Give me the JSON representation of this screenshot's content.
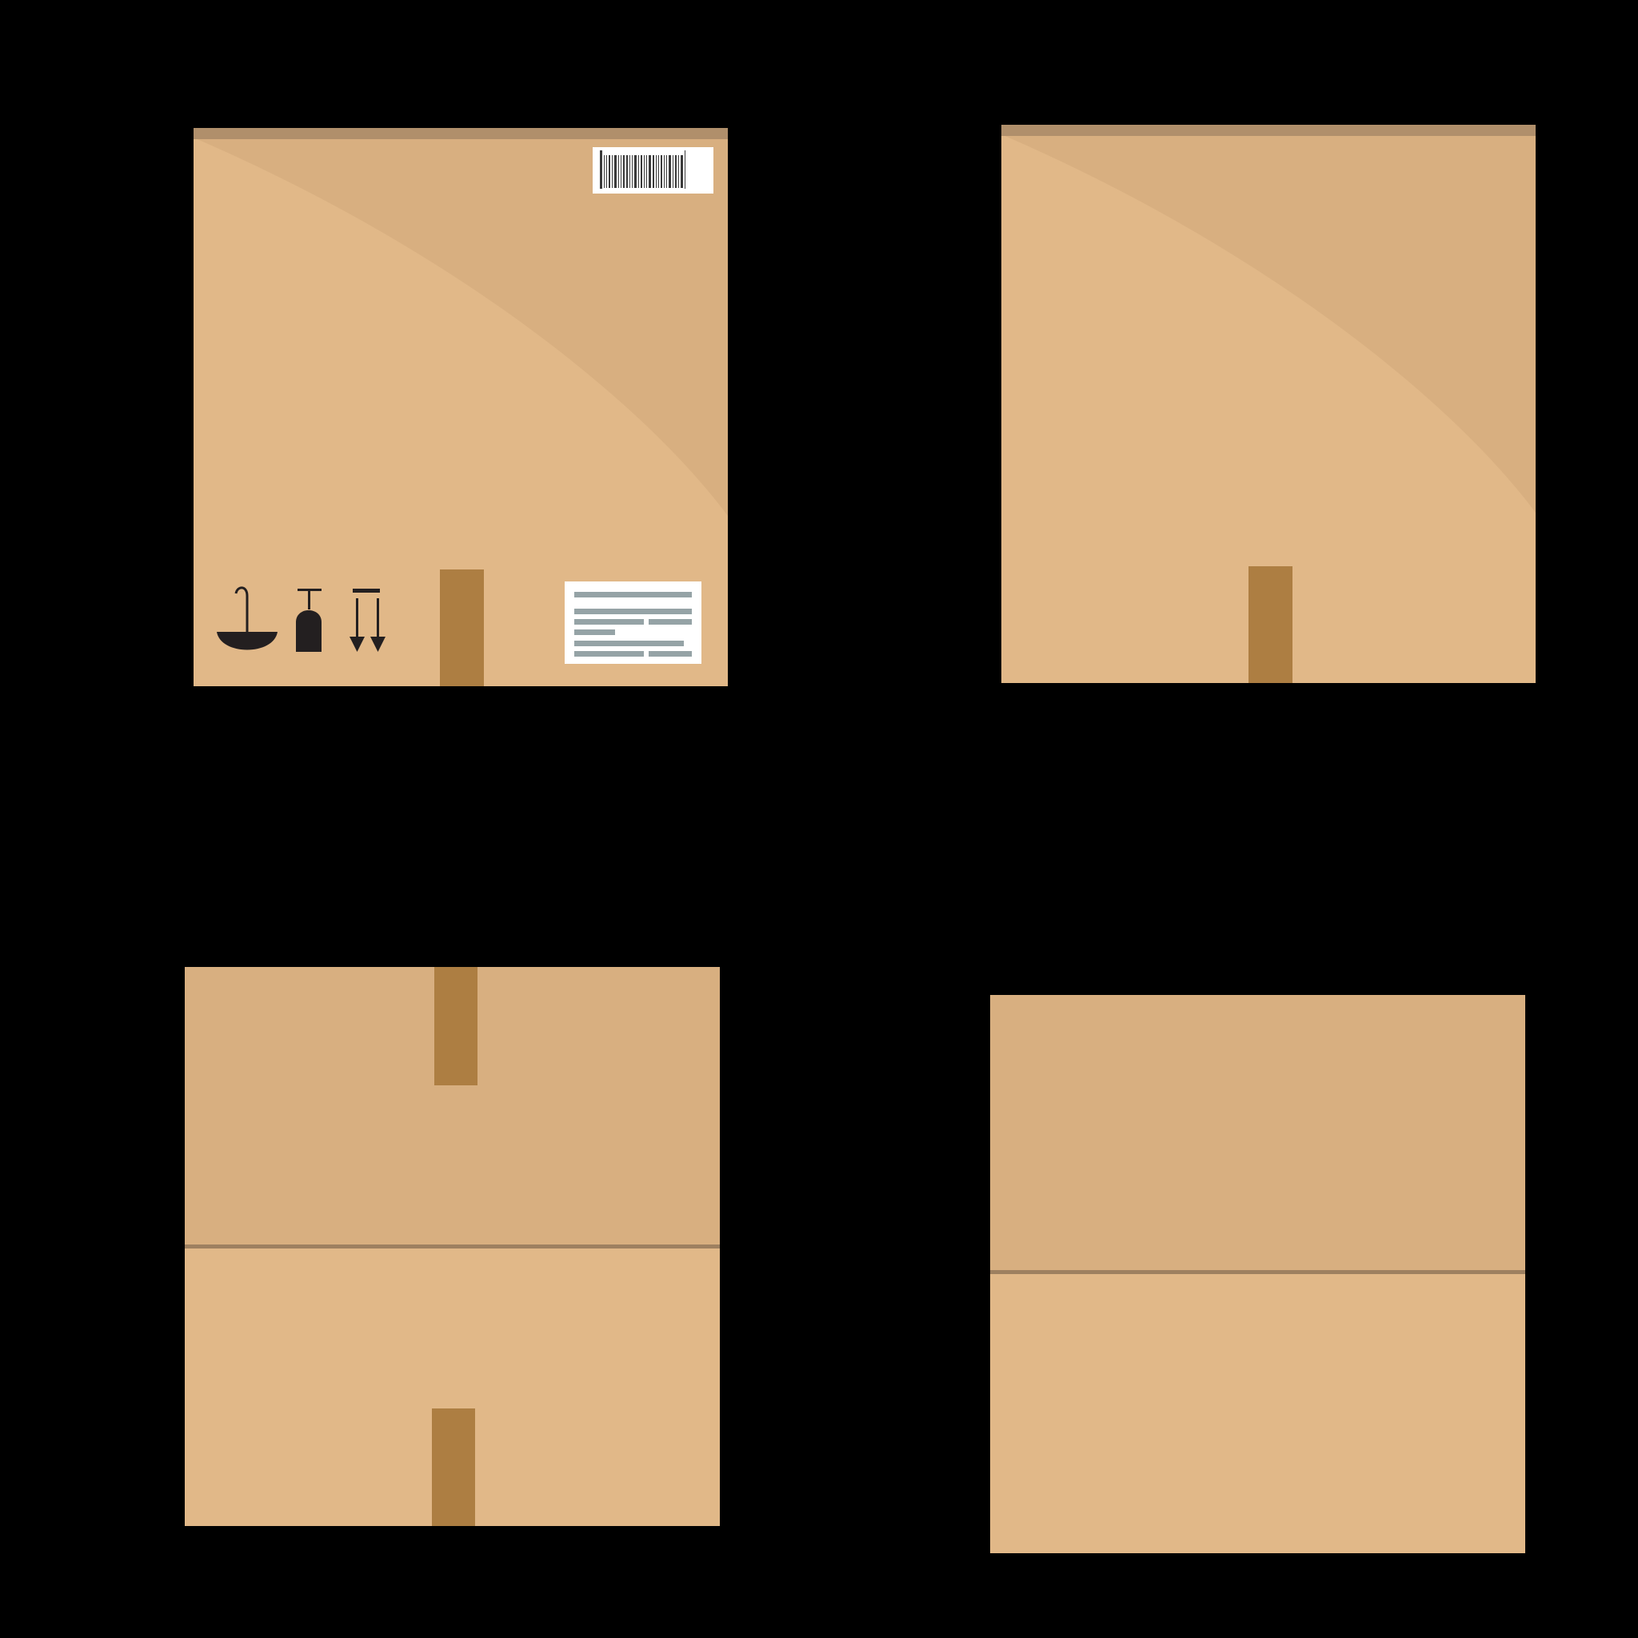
{
  "colors": {
    "background": "#000000",
    "cardboard_light": "#e1b888",
    "cardboard_mid": "#d8af80",
    "cardboard_edge": "#b08f6b",
    "tape": "#ad7e42",
    "seam": "#9e8060",
    "label_paper": "#ffffff",
    "label_text_lines": "#95a3a6",
    "barcode": "#3a3a3a",
    "symbols": "#231f20"
  },
  "boxes": [
    {
      "id": "box-front-labeled",
      "view": "front",
      "has_barcode": true,
      "has_address_label": true,
      "handling_symbols": [
        "keep-dry-icon",
        "fragile-glass-icon",
        "this-way-up-icon"
      ],
      "tape_positions": [
        "bottom"
      ]
    },
    {
      "id": "box-front-plain",
      "view": "front",
      "has_barcode": false,
      "has_address_label": false,
      "handling_symbols": [],
      "tape_positions": [
        "bottom"
      ]
    },
    {
      "id": "box-side-taped",
      "view": "side",
      "has_barcode": false,
      "has_address_label": false,
      "handling_symbols": [],
      "tape_positions": [
        "top",
        "bottom"
      ]
    },
    {
      "id": "box-side-plain",
      "view": "side",
      "has_barcode": false,
      "has_address_label": false,
      "handling_symbols": [],
      "tape_positions": []
    }
  ]
}
